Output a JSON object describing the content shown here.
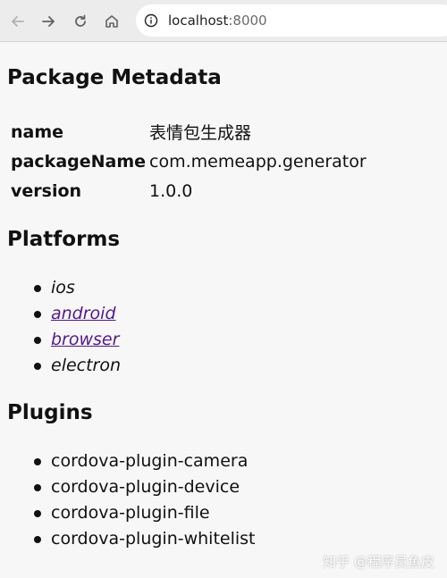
{
  "browser": {
    "url_host": "localhost",
    "url_port": ":8000"
  },
  "sections": {
    "metadata_title": "Package Metadata",
    "platforms_title": "Platforms",
    "plugins_title": "Plugins"
  },
  "metadata": [
    {
      "key": "name",
      "value": "表情包生成器"
    },
    {
      "key": "packageName",
      "value": "com.memeapp.generator"
    },
    {
      "key": "version",
      "value": "1.0.0"
    }
  ],
  "platforms": [
    {
      "label": "ios",
      "link": false
    },
    {
      "label": "android",
      "link": true
    },
    {
      "label": "browser",
      "link": true
    },
    {
      "label": "electron",
      "link": false
    }
  ],
  "plugins": [
    "cordova-plugin-camera",
    "cordova-plugin-device",
    "cordova-plugin-file",
    "cordova-plugin-whitelist"
  ],
  "watermark": "知乎 @程序员鱼皮",
  "colors": {
    "link_visited": "#551a8b",
    "chrome_bg": "#ececec"
  }
}
